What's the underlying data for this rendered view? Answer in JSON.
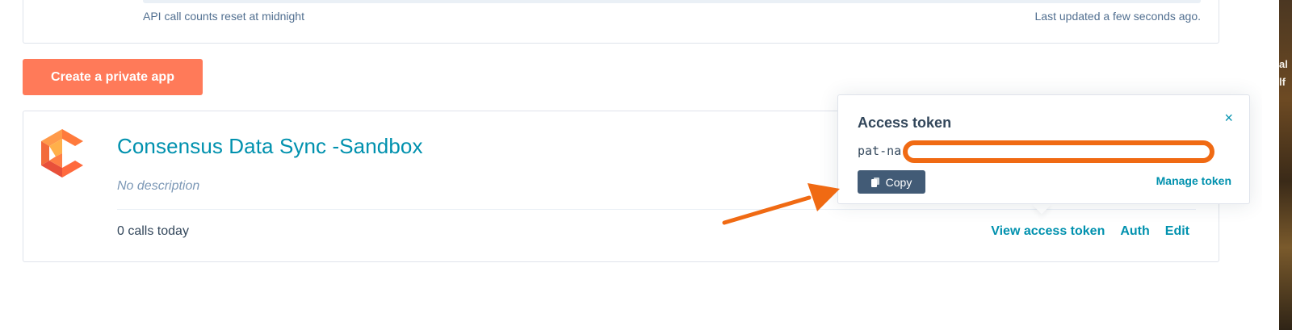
{
  "usage": {
    "reset_text": "API call counts reset at midnight",
    "updated_text": "Last updated a few seconds ago."
  },
  "create_button": {
    "label": "Create a private app"
  },
  "app": {
    "name": "Consensus Data Sync -Sandbox",
    "description": "No description",
    "calls": "0 calls today",
    "actions": {
      "view_token": "View access token",
      "auth": "Auth",
      "edit": "Edit"
    }
  },
  "popover": {
    "title": "Access token",
    "close": "×",
    "token_visible": "pat-na",
    "copy_label": "Copy",
    "manage_label": "Manage token"
  },
  "edge_fragments": [
    "al",
    "lf"
  ],
  "icons": {
    "logo": "consensus-logo-icon",
    "copy": "copy-icon",
    "close": "close-icon"
  },
  "colors": {
    "accent": "#0091ae",
    "primary_button": "#ff7a59",
    "secondary_button": "#425b76",
    "annotation": "#f06a13",
    "text": "#33475b"
  }
}
